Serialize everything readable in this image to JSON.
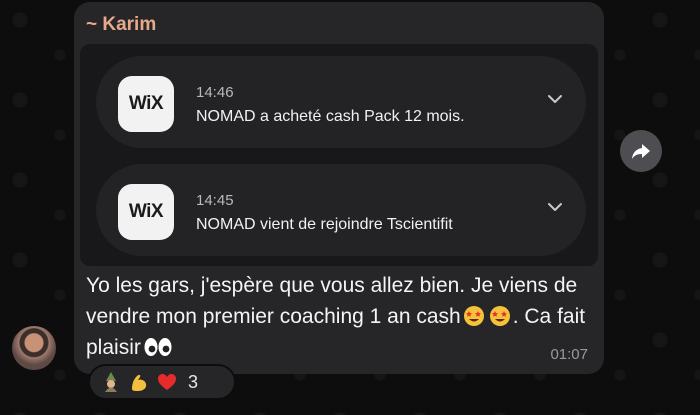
{
  "message": {
    "sender": "~ Karim",
    "notifications": [
      {
        "app_icon_text": "WiX",
        "time": "14:46",
        "text": "NOMAD a acheté cash Pack 12 mois."
      },
      {
        "app_icon_text": "WiX",
        "time": "14:45",
        "text": "NOMAD vient de rejoindre Tscientifit"
      }
    ],
    "text_part1": "Yo les gars, j'espère que vous allez bien. Je viens de vendre mon premier coaching 1 an cash",
    "text_part2": ". Ca fait plaisir",
    "inline_emojis": [
      "star-struck-emoji",
      "star-struck-emoji",
      "eyes-emoji"
    ],
    "time": "01:07"
  },
  "reactions": {
    "icons": [
      "mage-emoji",
      "flexed-biceps-emoji",
      "red-heart-emoji"
    ],
    "count": "3"
  },
  "forward_icon": "forward-arrow-icon",
  "colors": {
    "sender": "#e8a98b",
    "bubble": "#262628",
    "background": "#0d0d0e"
  }
}
